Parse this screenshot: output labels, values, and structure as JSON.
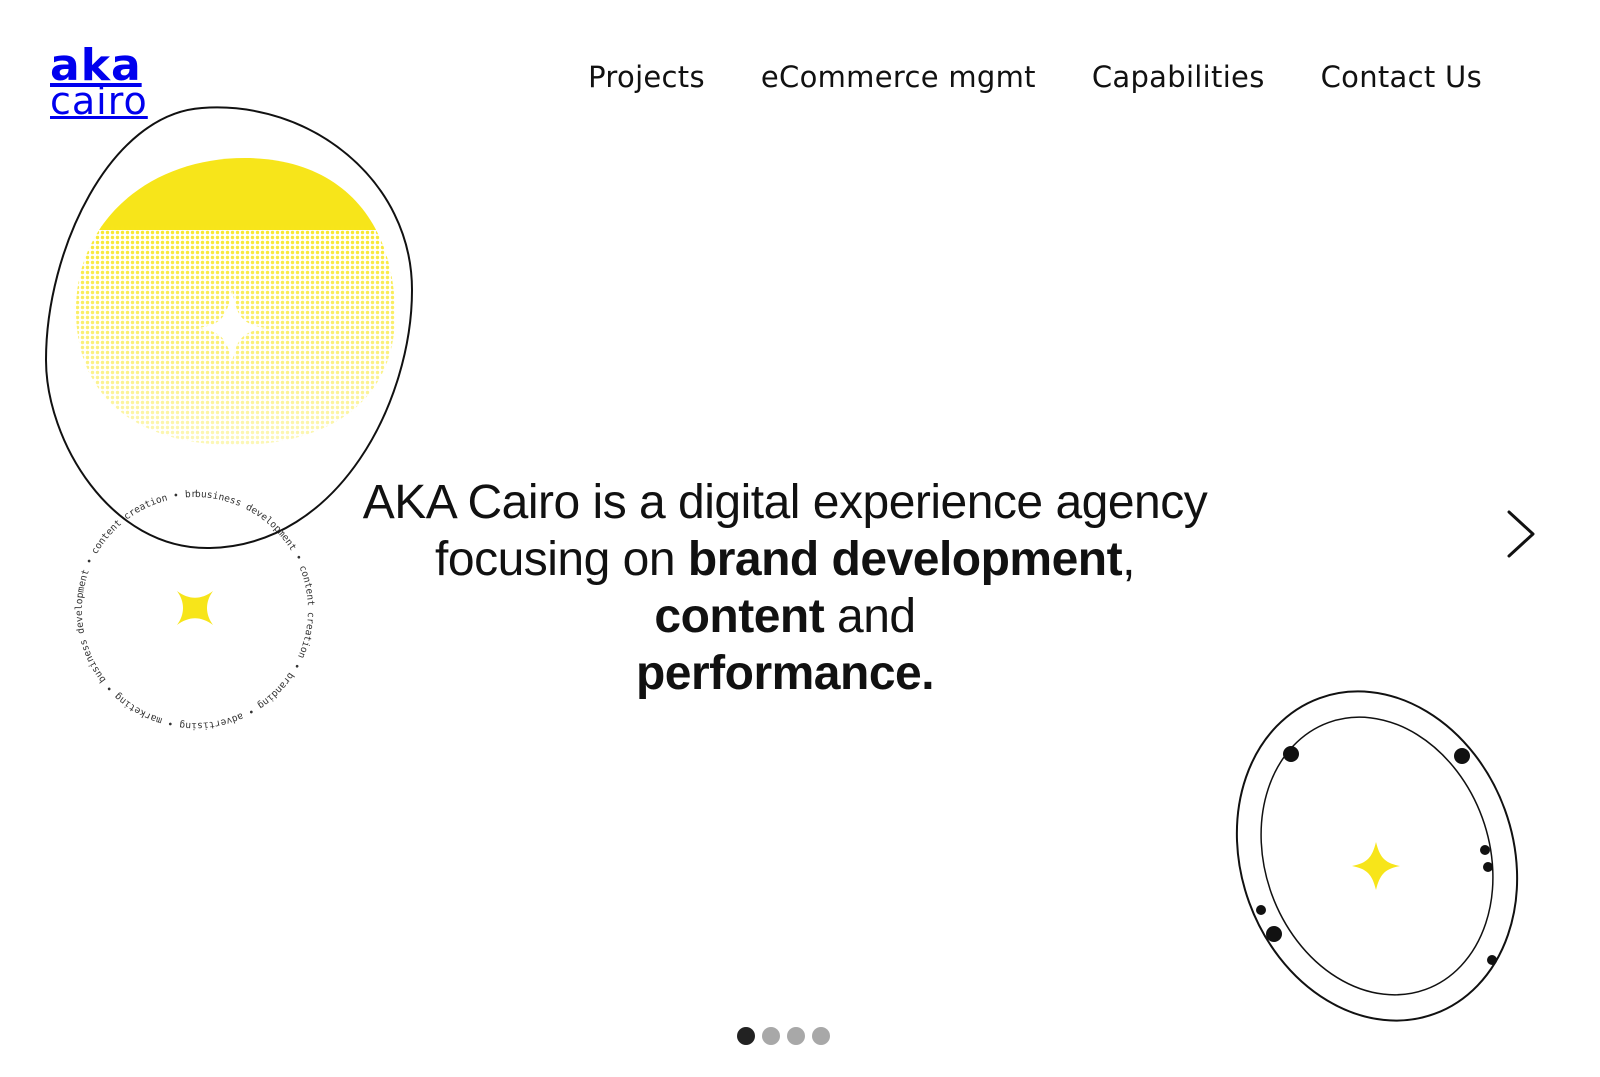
{
  "brand": {
    "line1": "aka",
    "line2": "cairo"
  },
  "nav": {
    "items": [
      {
        "label": "Projects"
      },
      {
        "label": "eCommerce mgmt"
      },
      {
        "label": "Capabilities"
      },
      {
        "label": "Contact Us"
      }
    ]
  },
  "hero": {
    "part1": "AKA Cairo is a digital experience agency focusing on ",
    "bold1": "brand development",
    "part2": ", ",
    "bold2": "content",
    "part3": " and ",
    "bold3": "performance."
  },
  "badge": {
    "ring_text": "business development • content creation • branding • advertising • marketing • business development • content creation • branding • advertising • marketing •"
  },
  "carousel": {
    "active_slide": 1,
    "total_slides": 4
  },
  "icons": {
    "next": "chevron-right-icon",
    "sparkle": "sparkle-icon"
  },
  "colors": {
    "accent_yellow": "#F7E51A",
    "ink": "#111111",
    "dot_inactive": "#A8A8A8",
    "dot_active": "#222222"
  }
}
